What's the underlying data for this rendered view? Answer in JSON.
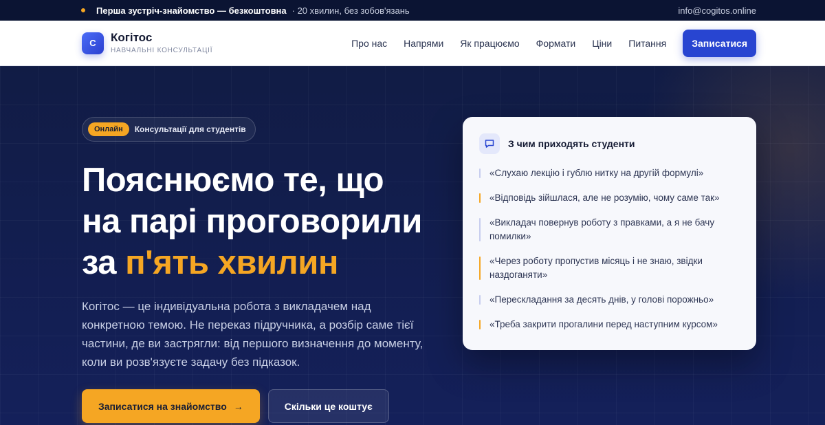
{
  "topbar": {
    "promo_strong": "Перша зустріч-знайомство — безкоштовна",
    "promo_rest": "· 20 хвилин, без зобов'язань",
    "email": "info@cogitos.online"
  },
  "brand": {
    "logo_letter": "C",
    "name": "Когітос",
    "subtitle": "НАВЧАЛЬНІ КОНСУЛЬТАЦІЇ"
  },
  "nav": {
    "items": [
      {
        "label": "Про нас"
      },
      {
        "label": "Напрями"
      },
      {
        "label": "Як працюємо"
      },
      {
        "label": "Формати"
      },
      {
        "label": "Ціни"
      },
      {
        "label": "Питання"
      }
    ],
    "cta": "Записатися"
  },
  "hero": {
    "badge": "Онлайн",
    "pill_text": "Консультації для студентів",
    "title_line1": "Пояснюємо те, що",
    "title_line2": "на парі проговорили",
    "title_line3_prefix": "за ",
    "title_accent": "п'ять хвилин",
    "lead": "Когітос — це індивідуальна робота з викладачем над конкретною темою. Не переказ підручника, а розбір саме тієї частини, де ви застрягли: від першого визначення до моменту, коли ви розв'язуєте задачу без підказок.",
    "primary_button": "Записатися на знайомство",
    "primary_arrow": "→",
    "secondary_button": "Скільки це коштує"
  },
  "card": {
    "title": "З чим приходять студенти",
    "quotes": [
      {
        "text": "«Слухаю лекцію і гублю нитку на другій формулі»",
        "color": "#c7cdee"
      },
      {
        "text": "«Відповідь зійшлася, але не розумію, чому саме так»",
        "color": "#f5a623"
      },
      {
        "text": "«Викладач повернув роботу з правками, а я не бачу помилки»",
        "color": "#c7cdee"
      },
      {
        "text": "«Через роботу пропустив місяць і не знаю, звідки наздоганяти»",
        "color": "#f5a623"
      },
      {
        "text": "«Перескладання за десять днів, у голові порожньо»",
        "color": "#c7cdee"
      },
      {
        "text": "«Треба закрити прогалини перед наступним курсом»",
        "color": "#f5a623"
      }
    ]
  },
  "colors": {
    "accent": "#f5a623",
    "brand_blue": "#2845d1",
    "hero_bg": "#111c45"
  }
}
